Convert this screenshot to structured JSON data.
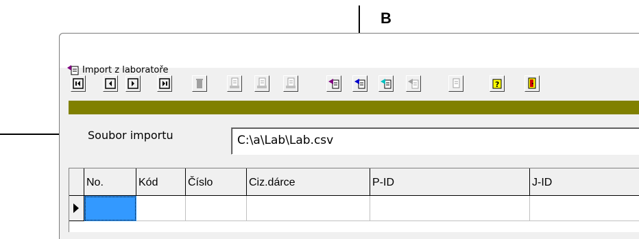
{
  "annotation": {
    "marker_label": "B"
  },
  "window": {
    "title": "Import z laboratoře"
  },
  "toolbar": {
    "buttons": [
      {
        "name": "first-record-button",
        "icon": "first-icon"
      },
      {
        "name": "prev-record-button",
        "icon": "prev-icon"
      },
      {
        "name": "next-record-button",
        "icon": "next-icon"
      },
      {
        "name": "last-record-button",
        "icon": "last-icon"
      },
      {
        "name": "delete-button",
        "icon": "trash-icon",
        "disabled": true
      },
      {
        "name": "doc-a-button",
        "icon": "document-icon",
        "disabled": true
      },
      {
        "name": "doc-b-button",
        "icon": "document-icon",
        "disabled": true
      },
      {
        "name": "doc-c-button",
        "icon": "document-icon",
        "disabled": true
      },
      {
        "name": "import-purple-button",
        "icon": "import-purple-icon"
      },
      {
        "name": "import-blue-button",
        "icon": "import-blue-icon"
      },
      {
        "name": "import-cyan-button",
        "icon": "import-cyan-icon"
      },
      {
        "name": "import-disabled-button",
        "icon": "import-icon",
        "disabled": true
      },
      {
        "name": "page-button",
        "icon": "page-icon",
        "disabled": true
      },
      {
        "name": "help-button",
        "icon": "help-icon"
      },
      {
        "name": "exit-button",
        "icon": "exit-door-icon"
      }
    ]
  },
  "import_file": {
    "label": "Soubor importu",
    "value": "C:\\a\\Lab\\Lab.csv"
  },
  "grid": {
    "columns": [
      "No.",
      "Kód",
      "Číslo",
      "Ciz.dárce",
      "P-ID",
      "J-ID"
    ]
  },
  "colors": {
    "status_bar": "#808000",
    "selection": "#3399ff"
  }
}
